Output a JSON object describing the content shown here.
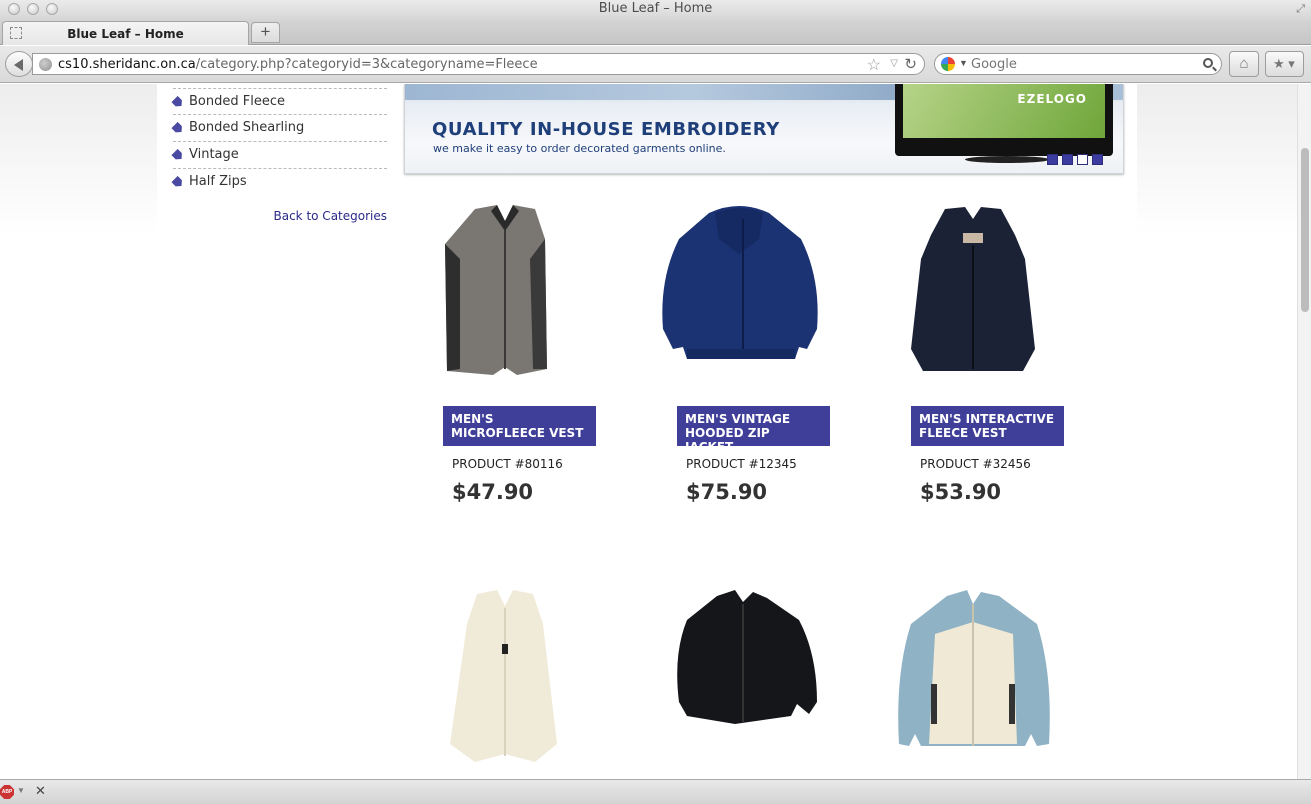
{
  "window": {
    "title": "Blue Leaf – Home"
  },
  "tab": {
    "title": "Blue Leaf – Home",
    "new_tab_label": "+"
  },
  "nav": {
    "url_domain": "cs10.sheridanc.on.ca",
    "url_path": "/category.php?categoryid=3&categoryname=Fleece",
    "search_placeholder": "Google"
  },
  "sidebar": {
    "items": [
      {
        "label": "Bonded Fleece"
      },
      {
        "label": "Bonded Shearling"
      },
      {
        "label": "Vintage"
      },
      {
        "label": "Half Zips"
      }
    ],
    "back_link": "Back to Categories"
  },
  "banner": {
    "headline": "QUALITY IN-HOUSE EMBROIDERY",
    "tagline": "we make it easy to order decorated garments online.",
    "monitor_logo": "EZELOGO",
    "slides_total": 4,
    "active_slide": 3
  },
  "products": [
    {
      "name": "MEN'S MICROFLEECE VEST",
      "number": "PRODUCT #80116",
      "price": "$47.90"
    },
    {
      "name": "MEN'S VINTAGE HOODED ZIP JACKET",
      "number": "PRODUCT #12345",
      "price": "$75.90"
    },
    {
      "name": "MEN'S INTERACTIVE FLEECE VEST",
      "number": "PRODUCT #32456",
      "price": "$53.90"
    }
  ],
  "statusbar": {
    "abp_label": "ABP",
    "close_label": "✕"
  },
  "colors": {
    "accent": "#3f3f9a",
    "link": "#2a2a8a"
  }
}
